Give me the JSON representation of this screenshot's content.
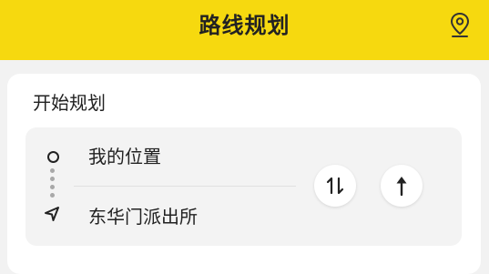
{
  "header": {
    "title": "路线规划",
    "location_icon": "location-pin-icon"
  },
  "planner": {
    "title": "开始规划",
    "origin": "我的位置",
    "destination": "东华门派出所",
    "swap_icon": "swap-icon",
    "go_icon": "arrow-up-icon"
  },
  "colors": {
    "accent": "#f6d90f",
    "background": "#f2f2f2",
    "card": "#ffffff",
    "route_box": "#f3f3f3",
    "text": "#222222"
  }
}
